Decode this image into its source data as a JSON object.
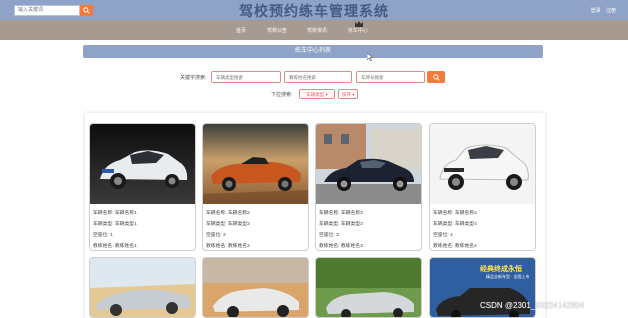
{
  "header": {
    "search_placeholder": "输入关键词",
    "title": "驾校预约练车管理系统",
    "links": [
      "登录",
      "注册"
    ]
  },
  "nav": {
    "items": [
      "首页",
      "驾校公告",
      "驾校资讯",
      "练车中心"
    ]
  },
  "section": {
    "title": "练车中心列表"
  },
  "filters": {
    "keyword_label": "关键字搜索:",
    "placeholders": [
      "车辆类型搜索",
      "教练姓名搜索",
      "车牌号搜索"
    ],
    "sort_label": "下拉搜索:",
    "sort_options": [
      "车辆类型 ▾",
      "排序 ▾"
    ]
  },
  "cards": [
    {
      "name_label": "车辆名称:",
      "name": "车辆名称1",
      "type_label": "车辆类型:",
      "type": "车辆类型1",
      "seats_label": "空座位:",
      "seats": "1",
      "coach_label": "教练姓名:",
      "coach": "教练姓名1"
    },
    {
      "name_label": "车辆名称:",
      "name": "车辆名称2",
      "type_label": "车辆类型:",
      "type": "车辆类型2",
      "seats_label": "空座位:",
      "seats": "2",
      "coach_label": "教练姓名:",
      "coach": "教练姓名2"
    },
    {
      "name_label": "车辆名称:",
      "name": "车辆名称3",
      "type_label": "车辆类型:",
      "type": "车辆类型3",
      "seats_label": "空座位:",
      "seats": "3",
      "coach_label": "教练姓名:",
      "coach": "教练姓名3"
    },
    {
      "name_label": "车辆名称:",
      "name": "车辆名称4",
      "type_label": "车辆类型:",
      "type": "车辆类型4",
      "seats_label": "空座位:",
      "seats": "4",
      "coach_label": "教练姓名:",
      "coach": "教练姓名4"
    }
  ],
  "partial_card_text": [
    "经典终成永恒",
    "精品全新车型 · 全国上市"
  ],
  "watermark": "CSDN @2301_83224142804",
  "colors": {
    "header": "#8ea3c7",
    "nav": "#a79a91",
    "accent": "#f27a3a",
    "title_text": "#465a86"
  }
}
